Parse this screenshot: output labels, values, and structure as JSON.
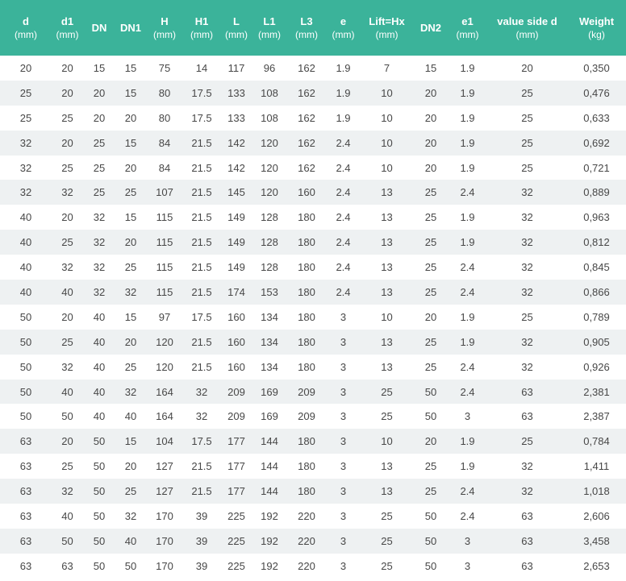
{
  "table": {
    "headers": [
      {
        "name": "d",
        "unit": "(mm)"
      },
      {
        "name": "d1",
        "unit": "(mm)"
      },
      {
        "name": "DN",
        "unit": ""
      },
      {
        "name": "DN1",
        "unit": ""
      },
      {
        "name": "H",
        "unit": "(mm)"
      },
      {
        "name": "H1",
        "unit": "(mm)"
      },
      {
        "name": "L",
        "unit": "(mm)"
      },
      {
        "name": "L1",
        "unit": "(mm)"
      },
      {
        "name": "L3",
        "unit": "(mm)"
      },
      {
        "name": "e",
        "unit": "(mm)"
      },
      {
        "name": "Lift=Hx",
        "unit": "(mm)"
      },
      {
        "name": "DN2",
        "unit": ""
      },
      {
        "name": "e1",
        "unit": "(mm)"
      },
      {
        "name": "value side d",
        "unit": "(mm)"
      },
      {
        "name": "Weight",
        "unit": "(kg)"
      }
    ],
    "rows": [
      [
        "20",
        "20",
        "15",
        "15",
        "75",
        "14",
        "117",
        "96",
        "162",
        "1.9",
        "7",
        "15",
        "1.9",
        "20",
        "0,350"
      ],
      [
        "25",
        "20",
        "20",
        "15",
        "80",
        "17.5",
        "133",
        "108",
        "162",
        "1.9",
        "10",
        "20",
        "1.9",
        "25",
        "0,476"
      ],
      [
        "25",
        "25",
        "20",
        "20",
        "80",
        "17.5",
        "133",
        "108",
        "162",
        "1.9",
        "10",
        "20",
        "1.9",
        "25",
        "0,633"
      ],
      [
        "32",
        "20",
        "25",
        "15",
        "84",
        "21.5",
        "142",
        "120",
        "162",
        "2.4",
        "10",
        "20",
        "1.9",
        "25",
        "0,692"
      ],
      [
        "32",
        "25",
        "25",
        "20",
        "84",
        "21.5",
        "142",
        "120",
        "162",
        "2.4",
        "10",
        "20",
        "1.9",
        "25",
        "0,721"
      ],
      [
        "32",
        "32",
        "25",
        "25",
        "107",
        "21.5",
        "145",
        "120",
        "160",
        "2.4",
        "13",
        "25",
        "2.4",
        "32",
        "0,889"
      ],
      [
        "40",
        "20",
        "32",
        "15",
        "115",
        "21.5",
        "149",
        "128",
        "180",
        "2.4",
        "13",
        "25",
        "1.9",
        "32",
        "0,963"
      ],
      [
        "40",
        "25",
        "32",
        "20",
        "115",
        "21.5",
        "149",
        "128",
        "180",
        "2.4",
        "13",
        "25",
        "1.9",
        "32",
        "0,812"
      ],
      [
        "40",
        "32",
        "32",
        "25",
        "115",
        "21.5",
        "149",
        "128",
        "180",
        "2.4",
        "13",
        "25",
        "2.4",
        "32",
        "0,845"
      ],
      [
        "40",
        "40",
        "32",
        "32",
        "115",
        "21.5",
        "174",
        "153",
        "180",
        "2.4",
        "13",
        "25",
        "2.4",
        "32",
        "0,866"
      ],
      [
        "50",
        "20",
        "40",
        "15",
        "97",
        "17.5",
        "160",
        "134",
        "180",
        "3",
        "10",
        "20",
        "1.9",
        "25",
        "0,789"
      ],
      [
        "50",
        "25",
        "40",
        "20",
        "120",
        "21.5",
        "160",
        "134",
        "180",
        "3",
        "13",
        "25",
        "1.9",
        "32",
        "0,905"
      ],
      [
        "50",
        "32",
        "40",
        "25",
        "120",
        "21.5",
        "160",
        "134",
        "180",
        "3",
        "13",
        "25",
        "2.4",
        "32",
        "0,926"
      ],
      [
        "50",
        "40",
        "40",
        "32",
        "164",
        "32",
        "209",
        "169",
        "209",
        "3",
        "25",
        "50",
        "2.4",
        "63",
        "2,381"
      ],
      [
        "50",
        "50",
        "40",
        "40",
        "164",
        "32",
        "209",
        "169",
        "209",
        "3",
        "25",
        "50",
        "3",
        "63",
        "2,387"
      ],
      [
        "63",
        "20",
        "50",
        "15",
        "104",
        "17.5",
        "177",
        "144",
        "180",
        "3",
        "10",
        "20",
        "1.9",
        "25",
        "0,784"
      ],
      [
        "63",
        "25",
        "50",
        "20",
        "127",
        "21.5",
        "177",
        "144",
        "180",
        "3",
        "13",
        "25",
        "1.9",
        "32",
        "1,411"
      ],
      [
        "63",
        "32",
        "50",
        "25",
        "127",
        "21.5",
        "177",
        "144",
        "180",
        "3",
        "13",
        "25",
        "2.4",
        "32",
        "1,018"
      ],
      [
        "63",
        "40",
        "50",
        "32",
        "170",
        "39",
        "225",
        "192",
        "220",
        "3",
        "25",
        "50",
        "2.4",
        "63",
        "2,606"
      ],
      [
        "63",
        "50",
        "50",
        "40",
        "170",
        "39",
        "225",
        "192",
        "220",
        "3",
        "25",
        "50",
        "3",
        "63",
        "3,458"
      ],
      [
        "63",
        "63",
        "50",
        "50",
        "170",
        "39",
        "225",
        "192",
        "220",
        "3",
        "25",
        "50",
        "3",
        "63",
        "2,653"
      ]
    ]
  },
  "colors": {
    "header_bg": "#3bb39a",
    "header_text": "#ffffff",
    "row_alt_bg": "#eef1f2",
    "cell_text": "#474747"
  }
}
